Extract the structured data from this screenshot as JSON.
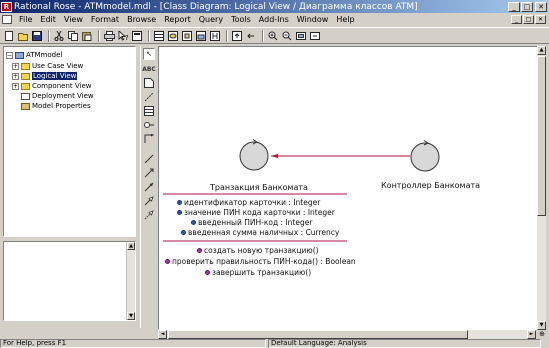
{
  "window": {
    "title": "Rational Rose - ATMmodel.mdl - [Class Diagram: Logical View / Диаграмма классов ATM]",
    "minimize_glyph": "_",
    "maximize_glyph": "□",
    "close_glyph": "✕"
  },
  "menu": {
    "items": [
      "File",
      "Edit",
      "View",
      "Format",
      "Browse",
      "Report",
      "Query",
      "Tools",
      "Add-Ins",
      "Window",
      "Help"
    ]
  },
  "toolbar": {
    "icons": [
      "new-icon",
      "open-icon",
      "save-icon",
      "cut-icon",
      "copy-icon",
      "paste-icon",
      "print-icon",
      "help-icon",
      "browse-diagram-icon",
      "class-diagram-icon",
      "usecase-diagram-icon",
      "component-diagram-icon",
      "deployment-diagram-icon",
      "sequence-diagram-icon",
      "parent-icon",
      "previous-icon",
      "zoom-in-icon",
      "zoom-out-icon",
      "fit-icon",
      "undo-fit-icon"
    ]
  },
  "browser": {
    "items": [
      {
        "label": "ATMmodel",
        "level": 0,
        "expander": "−",
        "icon": "model"
      },
      {
        "label": "Use Case View",
        "level": 1,
        "expander": "+",
        "icon": "folder"
      },
      {
        "label": "Logical View",
        "level": 1,
        "expander": "+",
        "icon": "folder",
        "selected": true
      },
      {
        "label": "Component View",
        "level": 1,
        "expander": "+",
        "icon": "folder"
      },
      {
        "label": "Deployment View",
        "level": 1,
        "expander": "",
        "icon": "doc"
      },
      {
        "label": "Model Properties",
        "level": 1,
        "expander": "",
        "icon": "prop"
      }
    ]
  },
  "toolbox": {
    "tools": [
      "selection-tool-icon",
      "text-box-tool-icon",
      "note-tool-icon",
      "anchor-note-tool-icon",
      "class-tool-icon",
      "interface-tool-icon",
      "unidirectional-association-tool-icon",
      "association-class-tool-icon",
      "package-tool-icon",
      "dependency-tool-icon",
      "generalization-tool-icon",
      "realize-tool-icon"
    ],
    "selection_glyph": "↖",
    "text_glyph": "ABC"
  },
  "diagram": {
    "classes": [
      {
        "name": "Транзакция Банкомата",
        "attributes": [
          "идентификатор карточки : Integer",
          "значение ПИН кода карточки : Integer",
          "введенный ПИН-код : Integer",
          "введенная сумма наличных : Currency"
        ],
        "operations": [
          "создать новую транзакцию()",
          "проверить правильность ПИН-кода() : Boolean",
          "завершить транзакцию()"
        ]
      },
      {
        "name": "Контроллер Банкомата",
        "attributes": [],
        "operations": []
      }
    ]
  },
  "scrollbars": {
    "up_glyph": "▲",
    "down_glyph": "▼",
    "left_glyph": "◄",
    "right_glyph": "►",
    "zoom_glyph": "⊕"
  },
  "statusbar": {
    "help_text": "For Help, press F1",
    "language": "Default Language: Analysis"
  }
}
